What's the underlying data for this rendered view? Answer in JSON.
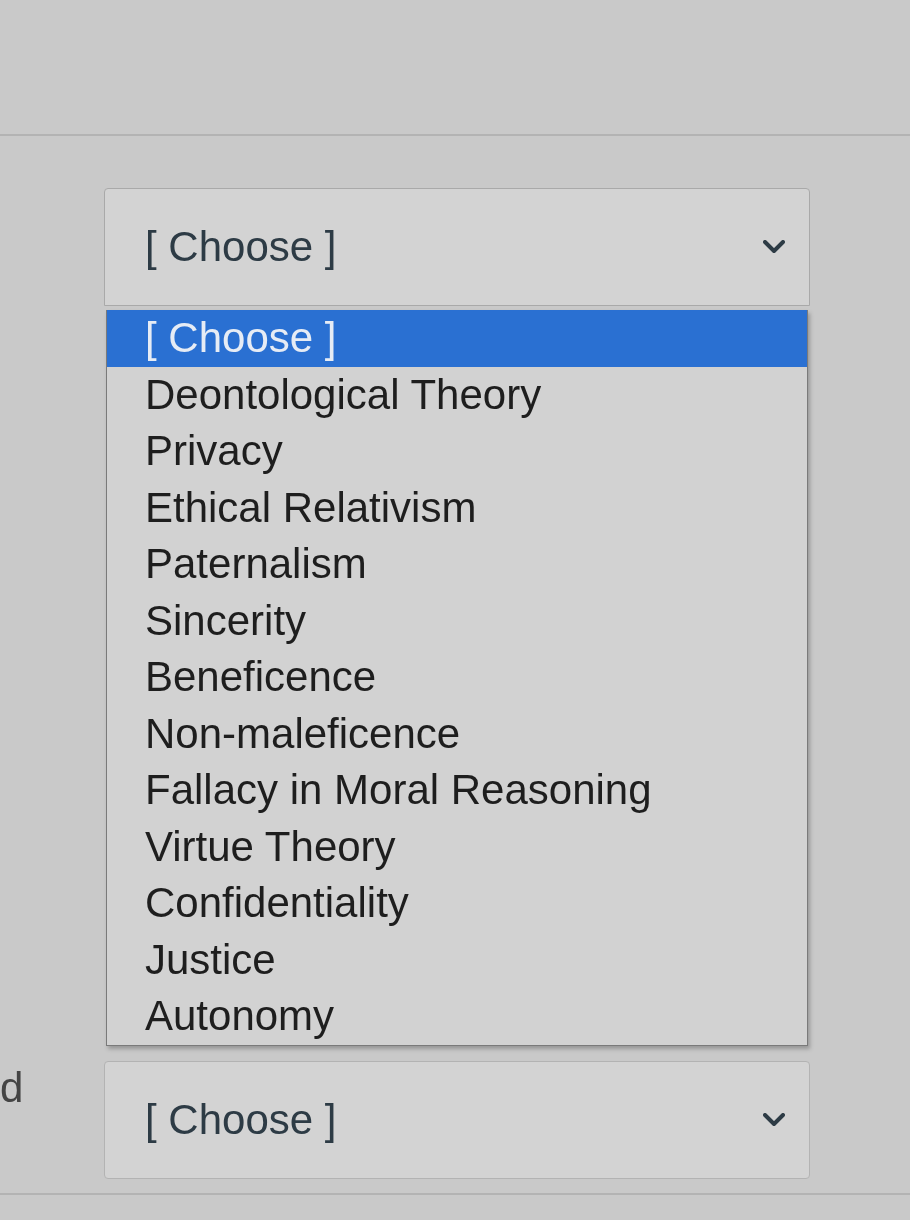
{
  "selects": [
    {
      "value": "[ Choose ]",
      "expanded": true,
      "options": [
        {
          "label": "[ Choose ]",
          "selected": true
        },
        {
          "label": "Deontological Theory",
          "selected": false
        },
        {
          "label": "Privacy",
          "selected": false
        },
        {
          "label": "Ethical Relativism",
          "selected": false
        },
        {
          "label": "Paternalism",
          "selected": false
        },
        {
          "label": "Sincerity",
          "selected": false
        },
        {
          "label": "Beneficence",
          "selected": false
        },
        {
          "label": "Non-maleficence",
          "selected": false
        },
        {
          "label": "Fallacy in Moral Reasoning",
          "selected": false
        },
        {
          "label": "Virtue Theory",
          "selected": false
        },
        {
          "label": "Confidentiality",
          "selected": false
        },
        {
          "label": "Justice",
          "selected": false
        },
        {
          "label": "Autonomy",
          "selected": false
        }
      ]
    },
    {
      "label": "d",
      "value": "[ Choose ]",
      "expanded": false
    }
  ]
}
